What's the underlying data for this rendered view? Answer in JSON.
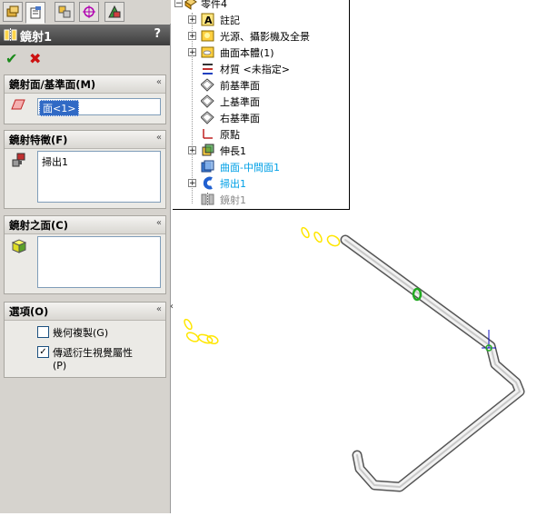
{
  "property_manager": {
    "tabs": [
      {
        "name": "feature-manager",
        "icon": "feature-tree-icon"
      },
      {
        "name": "property-manager",
        "icon": "property-manager-icon"
      },
      {
        "name": "configuration-manager",
        "icon": "configuration-icon"
      },
      {
        "name": "dimxpert-manager",
        "icon": "dimxpert-icon"
      },
      {
        "name": "display-manager",
        "icon": "display-manager-icon"
      }
    ],
    "title": "鏡射1",
    "help": "?",
    "ok_icon": "✔",
    "cancel_icon": "✖",
    "mirror_face": {
      "header": "鏡射面/基準面(M)",
      "value": "面<1>"
    },
    "features_to_mirror": {
      "header": "鏡射特徵(F)",
      "items": [
        "掃出1"
      ]
    },
    "faces_to_mirror": {
      "header": "鏡射之面(C)",
      "items": []
    },
    "options": {
      "header": "選項(O)",
      "geometry_pattern": {
        "label": "幾何複製(G)",
        "checked": false
      },
      "propagate_visual": {
        "label_line1": "傳遞衍生視覺屬性",
        "label_line2": "(P)",
        "checked": true
      }
    },
    "collapse_glyph": "«",
    "splitter_glyph": "‹"
  },
  "tree": {
    "items": [
      {
        "label": "零件4",
        "icon": "part-icon",
        "color": "#000000"
      },
      {
        "label": "註記",
        "icon": "annotations-icon",
        "color": "#000000"
      },
      {
        "label": "光源、攝影機及全景",
        "icon": "lights-camera-icon",
        "color": "#000000"
      },
      {
        "label": "曲面本體(1)",
        "icon": "surface-bodies-icon",
        "color": "#000000"
      },
      {
        "label": "材質 <未指定>",
        "icon": "material-icon",
        "color": "#000000"
      },
      {
        "label": "前基準面",
        "icon": "plane-icon",
        "color": "#000000"
      },
      {
        "label": "上基準面",
        "icon": "plane-icon",
        "color": "#000000"
      },
      {
        "label": "右基準面",
        "icon": "plane-icon",
        "color": "#000000"
      },
      {
        "label": "原點",
        "icon": "origin-icon",
        "color": "#000000"
      },
      {
        "label": "伸長1",
        "icon": "extrude-icon",
        "color": "#000000"
      },
      {
        "label": "曲面-中間面1",
        "icon": "midsurface-icon",
        "color": "#00a0e6"
      },
      {
        "label": "掃出1",
        "icon": "sweep-icon",
        "color": "#00a0e6"
      },
      {
        "label": "鏡射1",
        "icon": "mirror-icon",
        "color": "#8a8a8a"
      }
    ]
  },
  "colors": {
    "accent": "#316ac5",
    "highlight_blue": "#00a0e6",
    "selection_green": "#22aa22",
    "preview_yellow": "#ffe600"
  }
}
